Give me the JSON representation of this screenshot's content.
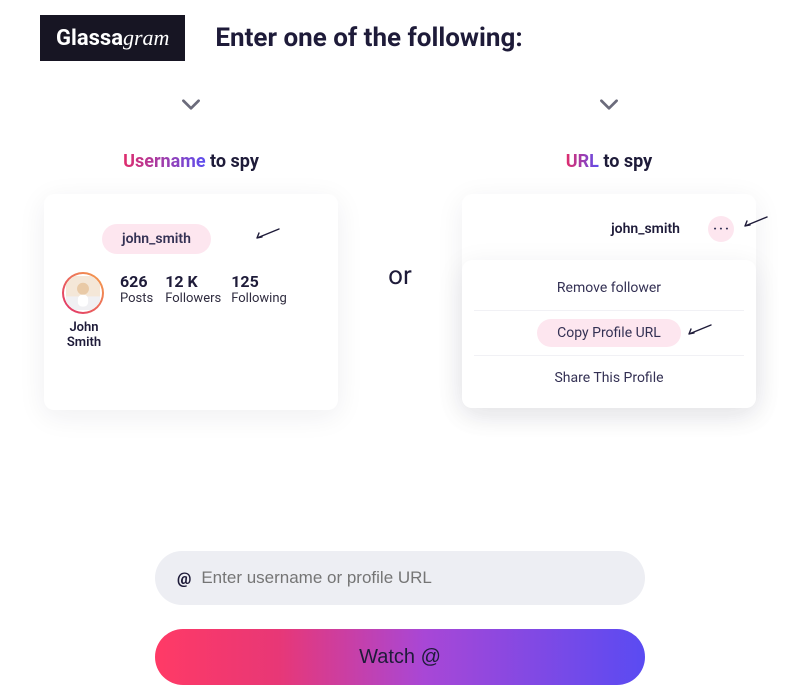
{
  "brand": {
    "part1": "Glassa",
    "part2": "gram"
  },
  "title": "Enter one of the following:",
  "left": {
    "heading_colored": "Username",
    "heading_rest": " to spy",
    "username": "john_smith",
    "display_name": "John Smith",
    "stats": [
      {
        "num": "626",
        "lbl": "Posts"
      },
      {
        "num": "12 K",
        "lbl": "Followers"
      },
      {
        "num": "125",
        "lbl": "Following"
      }
    ]
  },
  "mid": {
    "or": "or"
  },
  "right": {
    "heading_colored": "URL",
    "heading_rest": " to spy",
    "username": "john_smith",
    "menu": {
      "remove": "Remove follower",
      "copy": "Copy Profile URL",
      "share": "Share This Profile"
    }
  },
  "search": {
    "at": "@",
    "placeholder": "Enter username or profile URL"
  },
  "watch_button": "Watch @"
}
